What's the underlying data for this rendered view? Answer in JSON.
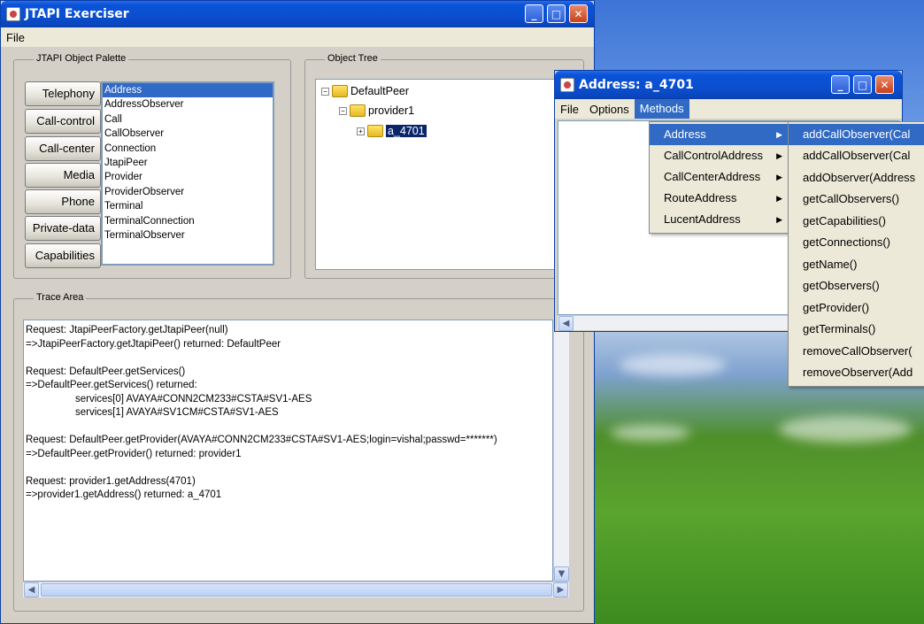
{
  "main_window": {
    "title": "JTAPI Exerciser",
    "menu": [
      "File"
    ],
    "palette": {
      "label": "JTAPI Object Palette",
      "buttons": [
        "Telephony",
        "Call-control",
        "Call-center",
        "Media",
        "Phone",
        "Private-data",
        "Capabilities"
      ],
      "list": [
        "Address",
        "AddressObserver",
        "Call",
        "CallObserver",
        "Connection",
        "JtapiPeer",
        "Provider",
        "ProviderObserver",
        "Terminal",
        "TerminalConnection",
        "TerminalObserver"
      ],
      "selected": "Address"
    },
    "object_tree": {
      "label": "Object Tree",
      "root": "DefaultPeer",
      "child": "provider1",
      "leaf": "a_4701"
    },
    "trace": {
      "label": "Trace Area",
      "lines": [
        "Request: JtapiPeerFactory.getJtapiPeer(null)",
        "=>JtapiPeerFactory.getJtapiPeer() returned: DefaultPeer",
        "",
        "Request: DefaultPeer.getServices()",
        "=>DefaultPeer.getServices() returned:",
        "services[0] AVAYA#CONN2CM233#CSTA#SV1-AES",
        "services[1] AVAYA#SV1CM#CSTA#SV1-AES",
        "",
        "Request: DefaultPeer.getProvider(AVAYA#CONN2CM233#CSTA#SV1-AES;login=vishal;passwd=*******)",
        "=>DefaultPeer.getProvider() returned: provider1",
        "",
        "Request: provider1.getAddress(4701)",
        "=>provider1.getAddress() returned: a_4701"
      ]
    }
  },
  "address_window": {
    "title": "Address: a_4701",
    "menu": [
      "File",
      "Options",
      "Methods"
    ],
    "methods_menu": [
      "Address",
      "CallControlAddress",
      "CallCenterAddress",
      "RouteAddress",
      "LucentAddress"
    ],
    "address_submenu": [
      "addCallObserver(Cal",
      "addCallObserver(Cal",
      "addObserver(Address",
      "getCallObservers()",
      "getCapabilities()",
      "getConnections()",
      "getName()",
      "getObservers()",
      "getProvider()",
      "getTerminals()",
      "removeCallObserver(",
      "removeObserver(Add"
    ]
  },
  "colors": {
    "selection": "#316ac5",
    "titlebar": "#0a52d8"
  }
}
